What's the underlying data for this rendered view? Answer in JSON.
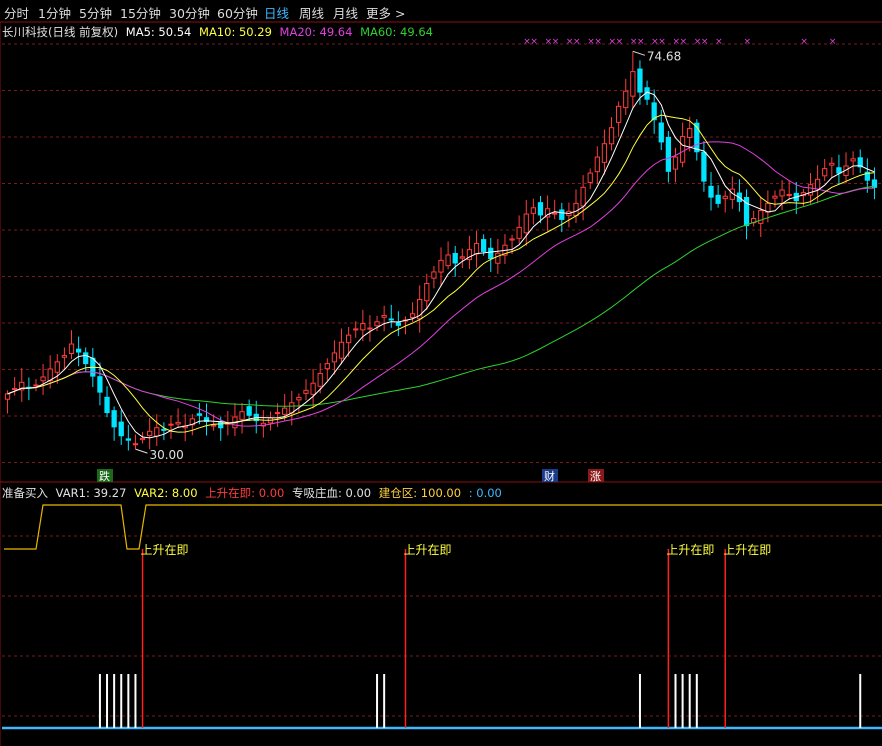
{
  "toolbar": {
    "items": [
      "分时",
      "1分钟",
      "5分钟",
      "15分钟",
      "30分钟",
      "60分钟",
      "日线",
      "周线",
      "月线",
      "更多 >"
    ],
    "active": "日线"
  },
  "main": {
    "title": "长川科技(日线 前复权)",
    "ma5": "MA5: 50.54",
    "ma10": "MA10: 50.29",
    "ma20": "MA20: 49.64",
    "ma60": "MA60: 49.64",
    "high_label": "74.68",
    "low_label": "30.00",
    "badge_die": "跌",
    "badge_cai": "财",
    "badge_zhang": "涨"
  },
  "sub": {
    "name": "准备买入",
    "var1": "VAR1: 39.27",
    "var2": "VAR2: 8.00",
    "rise": "上升在即: 0.00",
    "absorb": "专吸庄血: 0.00",
    "build": "建仓区: 100.00",
    "last": ": 0.00",
    "signal_label": "上升在即"
  },
  "colors": {
    "ma5": "#ffffff",
    "ma10": "#ffff40",
    "ma20": "#e040e0",
    "ma60": "#30d030",
    "up": "#ff3c3c",
    "down": "#00e4ff",
    "grid": "#7a1a1a"
  },
  "chart_data": [
    {
      "type": "candlestick",
      "title": "长川科技(日线 前复权)",
      "price_range": [
        30.0,
        74.68
      ],
      "series": [
        {
          "name": "MA5",
          "last": 50.54
        },
        {
          "name": "MA10",
          "last": 50.29
        },
        {
          "name": "MA20",
          "last": 49.64
        },
        {
          "name": "MA60",
          "last": 49.64
        }
      ],
      "closes": [
        36.2,
        36.8,
        37.5,
        36.9,
        37.2,
        38.1,
        39.0,
        39.8,
        40.5,
        41.8,
        40.9,
        39.6,
        38.2,
        36.4,
        34.1,
        32.5,
        31.5,
        31.0,
        30.6,
        31.2,
        32.0,
        32.4,
        32.1,
        32.8,
        33.0,
        32.6,
        33.4,
        33.8,
        33.1,
        32.7,
        32.4,
        32.9,
        33.6,
        34.2,
        33.8,
        33.2,
        32.9,
        33.5,
        34.1,
        34.6,
        35.2,
        35.8,
        36.6,
        37.4,
        38.5,
        39.6,
        40.8,
        42.0,
        42.8,
        43.5,
        44.1,
        43.6,
        44.3,
        45.0,
        44.6,
        43.9,
        44.5,
        45.2,
        46.8,
        48.6,
        49.9,
        51.2,
        51.8,
        50.9,
        51.6,
        52.4,
        53.1,
        52.2,
        51.4,
        52.0,
        52.9,
        53.6,
        54.9,
        56.4,
        57.1,
        56.3,
        57.0,
        56.5,
        55.8,
        56.7,
        57.6,
        59.4,
        61.0,
        62.8,
        64.3,
        66.1,
        68.5,
        70.2,
        72.4,
        70.1,
        69.3,
        67.0,
        64.5,
        61.2,
        62.8,
        65.1,
        66.0,
        63.4,
        60.1,
        58.3,
        57.6,
        58.4,
        59.2,
        57.8,
        55.1,
        55.9,
        56.8,
        57.6,
        58.4,
        59.1,
        58.6,
        57.9,
        58.8,
        59.7,
        60.3,
        61.5,
        62.1,
        61.0,
        61.8,
        62.6,
        61.7,
        60.2,
        59.4
      ]
    },
    {
      "type": "indicator",
      "name": "准备买入",
      "VAR1": 39.27,
      "VAR2": 8.0,
      "上升在即": 0.0,
      "专吸庄血": 0.0,
      "建仓区": 100.0,
      "signals": [
        {
          "label": "上升在即",
          "bar": 19
        },
        {
          "label": "上升在即",
          "bar": 56
        },
        {
          "label": "上升在即",
          "bar": 93
        },
        {
          "label": "上升在即",
          "bar": 101
        }
      ]
    }
  ]
}
